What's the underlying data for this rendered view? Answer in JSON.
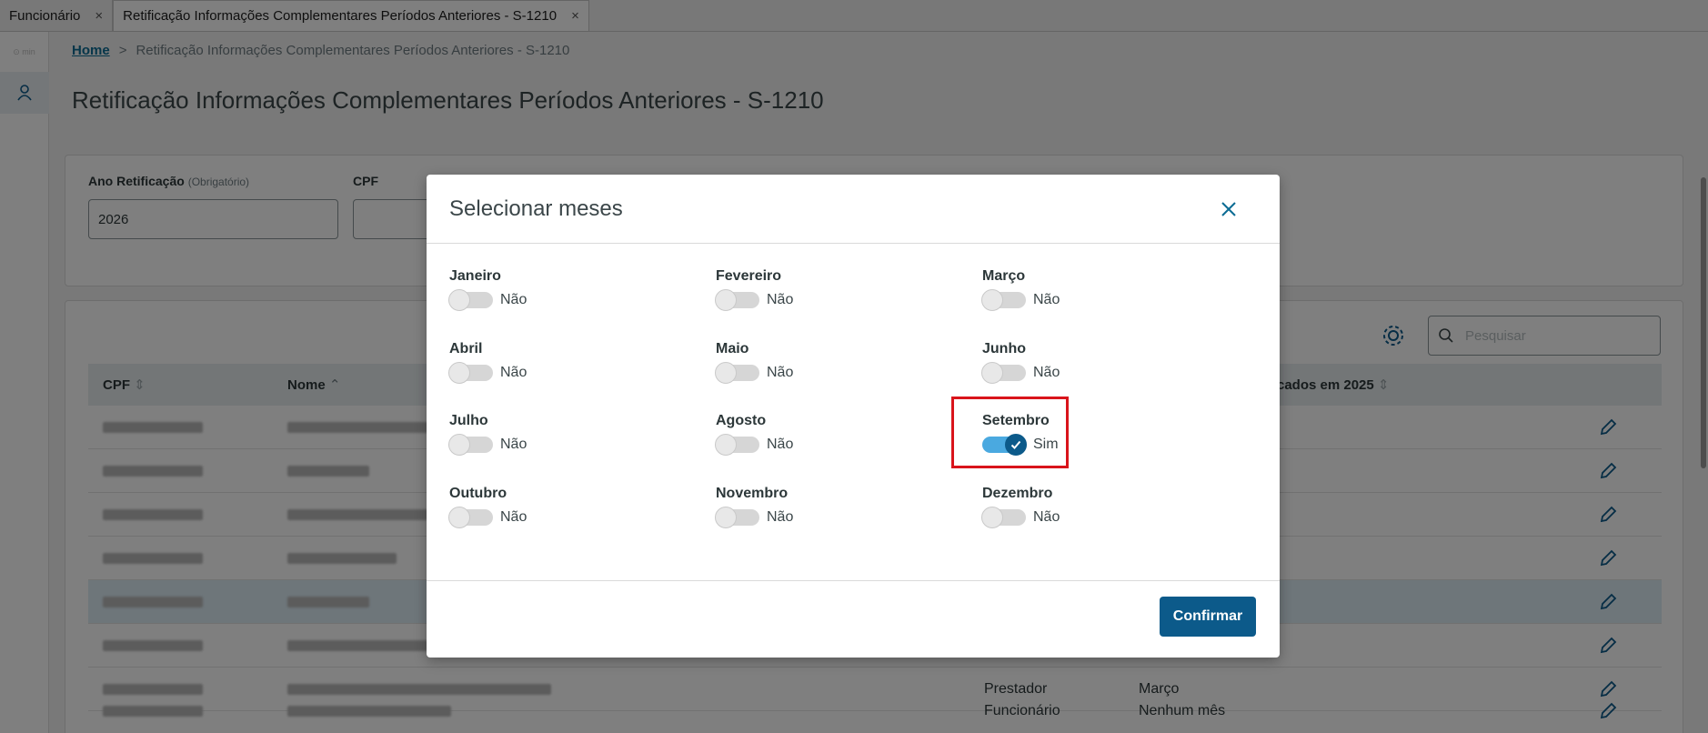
{
  "window_tabs": [
    {
      "label": "Funcionário",
      "close": "×"
    },
    {
      "label": "Retificação Informações Complementares Períodos Anteriores - S-1210",
      "close": "×"
    }
  ],
  "rail": {
    "top_text": "⊙ min"
  },
  "breadcrumb": {
    "home": "Home",
    "separator": ">",
    "current": "Retificação Informações Complementares Períodos Anteriores - S-1210"
  },
  "page": {
    "title": "Retificação Informações Complementares Períodos Anteriores - S-1210"
  },
  "filters": {
    "ano_label": "Ano Retificação",
    "ano_hint": "(Obrigatório)",
    "ano_value": "2026",
    "cpf_label": "CPF",
    "cpf_value": ""
  },
  "search": {
    "placeholder": "Pesquisar"
  },
  "table": {
    "columns": [
      "CPF",
      "Nome",
      "cados em 2025"
    ],
    "rows": [
      {
        "tipo": "",
        "meses": ""
      },
      {
        "tipo": "",
        "meses": ""
      },
      {
        "tipo": "",
        "meses": ""
      },
      {
        "tipo": "",
        "meses": ""
      },
      {
        "tipo": "",
        "meses": ""
      },
      {
        "tipo": "",
        "meses": ""
      },
      {
        "tipo": "Prestador",
        "meses": "Março"
      },
      {
        "tipo": "Funcionário",
        "meses": "Nenhum mês"
      }
    ]
  },
  "modal": {
    "title": "Selecionar meses",
    "months": [
      {
        "label": "Janeiro",
        "state": "Não",
        "on": false
      },
      {
        "label": "Fevereiro",
        "state": "Não",
        "on": false
      },
      {
        "label": "Março",
        "state": "Não",
        "on": false
      },
      {
        "label": "Abril",
        "state": "Não",
        "on": false
      },
      {
        "label": "Maio",
        "state": "Não",
        "on": false
      },
      {
        "label": "Junho",
        "state": "Não",
        "on": false
      },
      {
        "label": "Julho",
        "state": "Não",
        "on": false
      },
      {
        "label": "Agosto",
        "state": "Não",
        "on": false
      },
      {
        "label": "Setembro",
        "state": "Sim",
        "on": true
      },
      {
        "label": "Outubro",
        "state": "Não",
        "on": false
      },
      {
        "label": "Novembro",
        "state": "Não",
        "on": false
      },
      {
        "label": "Dezembro",
        "state": "Não",
        "on": false
      }
    ],
    "confirm_label": "Confirmar"
  },
  "colors": {
    "primary": "#0c5a8a",
    "switch_on": "#4aa9e0",
    "highlight_border": "#d9141b"
  }
}
